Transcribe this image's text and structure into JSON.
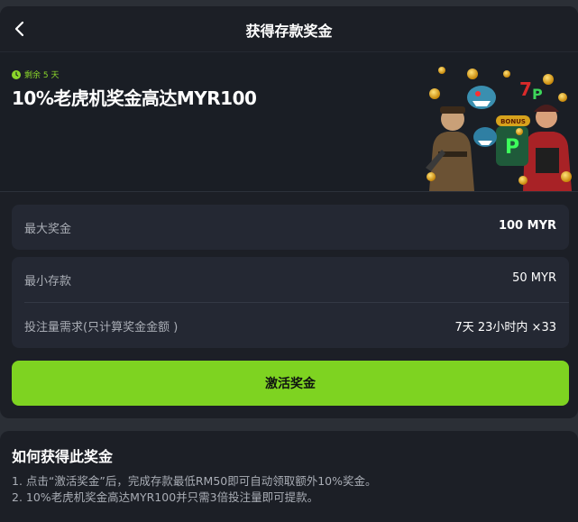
{
  "header": {
    "title": "获得存款奖金"
  },
  "promo": {
    "expiry": "剩余 5 天",
    "title": "10%老虎机奖金高达MYR100",
    "accent_color": "#8bd72a"
  },
  "details": {
    "max_bonus": {
      "label": "最大奖金",
      "value": "100 MYR"
    },
    "min_deposit": {
      "label": "最小存款",
      "value": "50 MYR"
    },
    "wagering": {
      "label": "投注量需求(只计算奖金金额 )",
      "value": "7天 23小时内 ×33"
    }
  },
  "actions": {
    "activate_label": "激活奖金",
    "activate_color": "#7ed321"
  },
  "howto": {
    "title": "如何获得此奖金",
    "lines": [
      "1. 点击“激活奖金”后，完成存款最低RM50即可自动领取额外10%奖金。",
      "2. 10%老虎机奖金高达MYR100并只需3倍投注量即可提款。"
    ]
  },
  "icons": {
    "back": "chevron-left-icon",
    "clock": "clock-icon"
  }
}
